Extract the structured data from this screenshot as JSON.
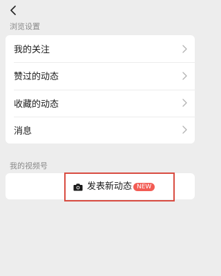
{
  "nav": {
    "back_icon": "chevron-left-icon"
  },
  "browse_settings": {
    "title": "浏览设置",
    "items": [
      {
        "label": "我的关注"
      },
      {
        "label": "赞过的动态"
      },
      {
        "label": "收藏的动态"
      },
      {
        "label": "消息"
      }
    ]
  },
  "my_channel": {
    "title": "我的视频号",
    "post_button": {
      "icon": "camera-icon",
      "label": "发表新动态",
      "badge": "NEW"
    }
  },
  "colors": {
    "background": "#ededed",
    "card": "#ffffff",
    "badge": "#f25c54",
    "highlight_border": "#d84a3f"
  }
}
